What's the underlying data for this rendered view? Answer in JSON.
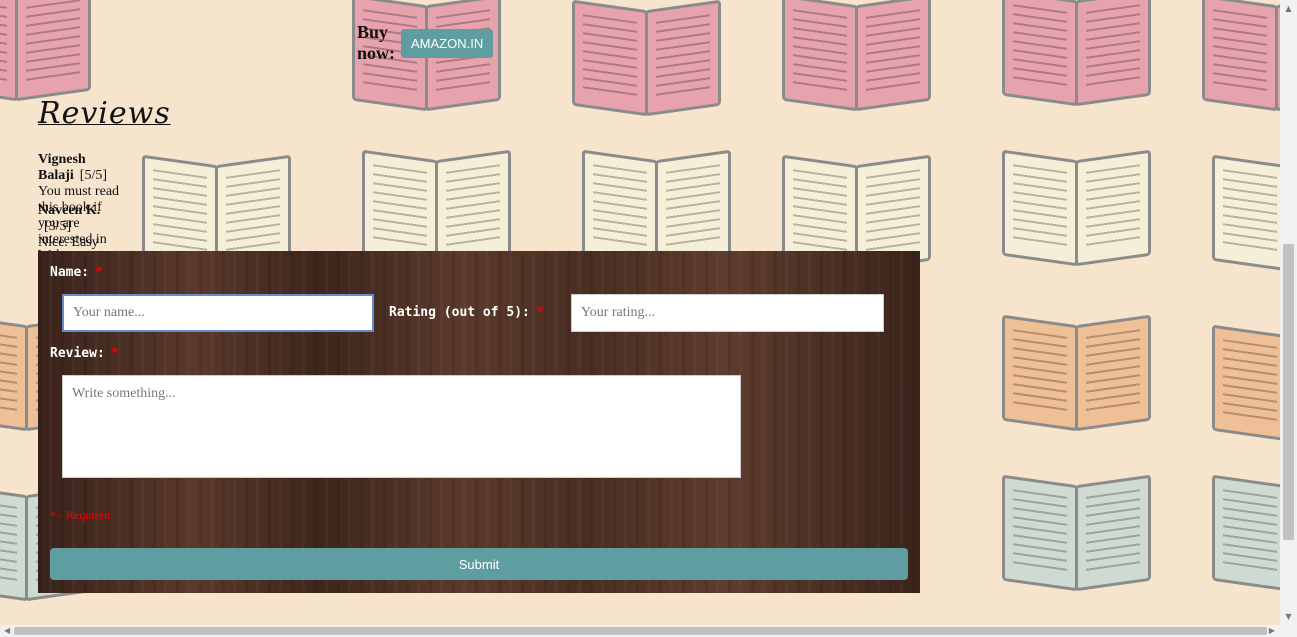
{
  "buy": {
    "label": "Buy now:",
    "amazon_button": "AMAZON.IN"
  },
  "reviews": {
    "title": "Reviews",
    "items": [
      {
        "name": "Vignesh Balaji",
        "rating": "[5/5]",
        "text": "You must read this book if you are interested in Web Programming!"
      },
      {
        "name": "Naveen K.",
        "rating": "[3/5]",
        "text": "Nice. Easy to understand."
      }
    ]
  },
  "form": {
    "name_label": "Name:",
    "name_placeholder": "Your name...",
    "rating_label": "Rating (out of 5):",
    "rating_placeholder": "Your rating...",
    "review_label": "Review:",
    "review_placeholder": "Write something...",
    "required_marker": "*",
    "required_note": "* - Required",
    "submit_label": "Submit"
  },
  "colors": {
    "accent": "#5f9ea0",
    "required": "#e00000",
    "background": "#f6e4cd"
  },
  "icons": {
    "scroll_up": "chevron-up-icon",
    "scroll_down": "chevron-down-icon",
    "scroll_left": "chevron-left-icon",
    "scroll_right": "chevron-right-icon"
  }
}
